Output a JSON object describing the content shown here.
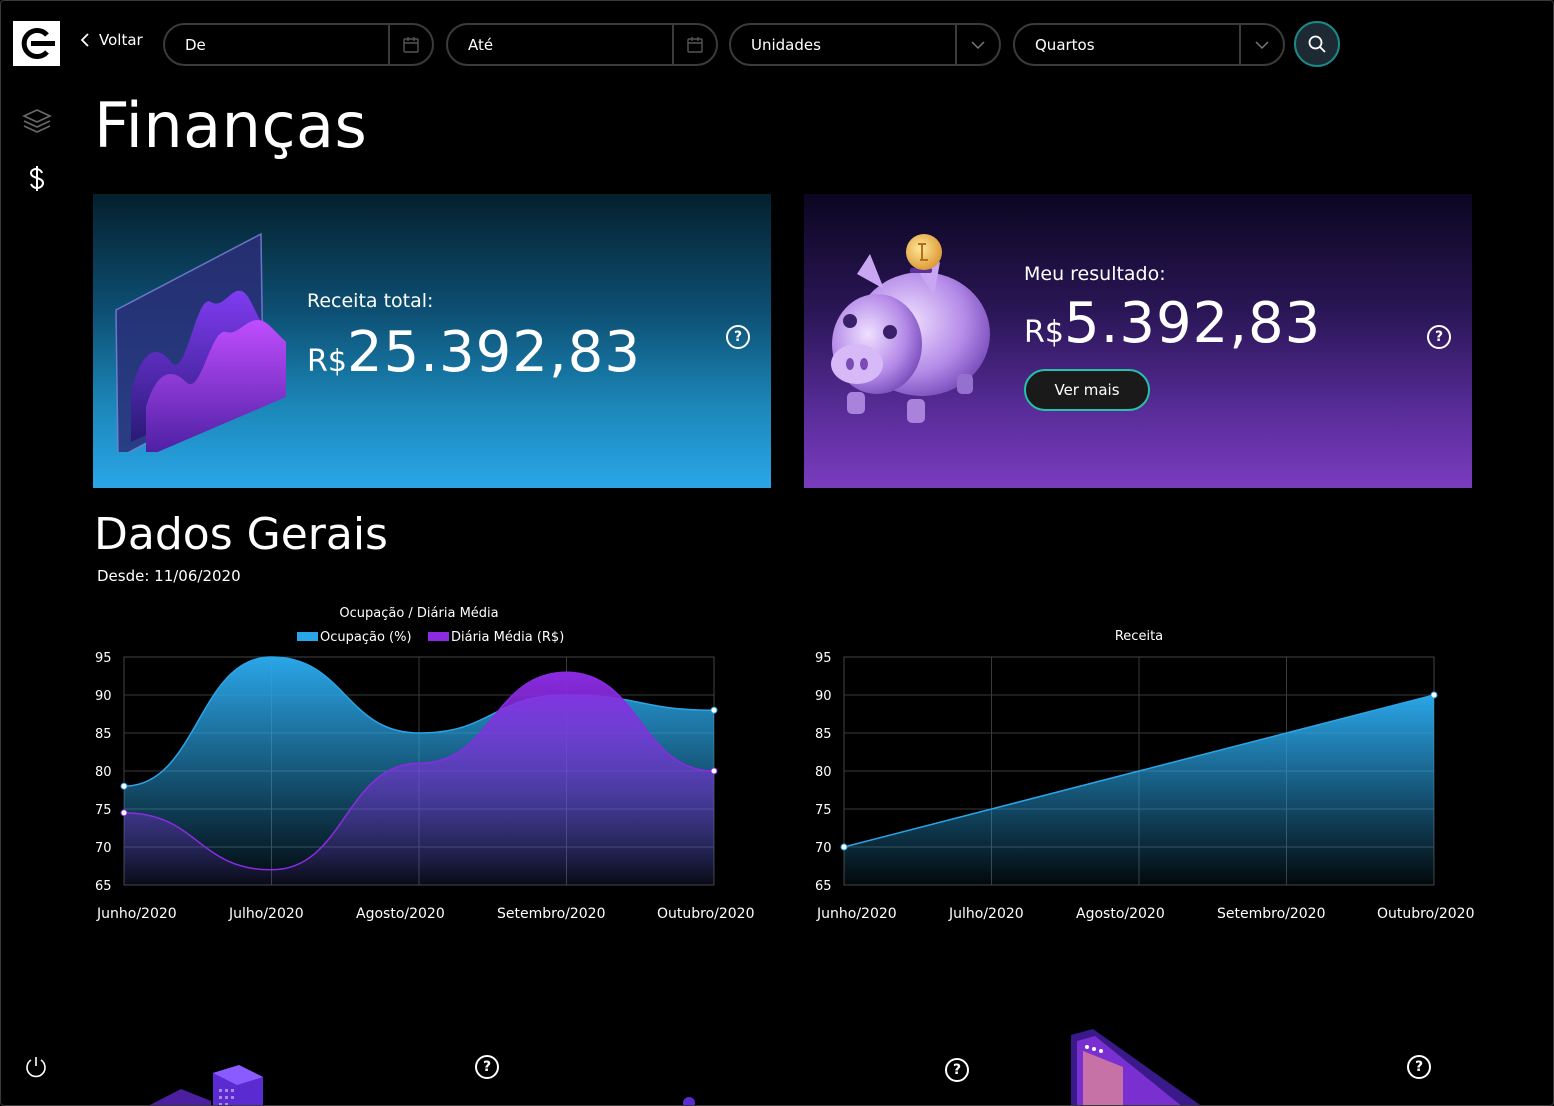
{
  "nav": {
    "back_label": "Voltar",
    "from_placeholder": "De",
    "to_placeholder": "Até",
    "units_label": "Unidades",
    "rooms_label": "Quartos"
  },
  "page": {
    "title": "Finanças",
    "section_title": "Dados Gerais",
    "since": "Desde: 11/06/2020"
  },
  "cards": {
    "revenue": {
      "label": "Receita total:",
      "currency": "R$",
      "amount": "25.392,83",
      "help": "?"
    },
    "result": {
      "label": "Meu resultado:",
      "currency": "R$",
      "amount": "5.392,83",
      "button": "Ver mais",
      "help": "?"
    }
  },
  "bottom_help": [
    "?",
    "?",
    "?"
  ],
  "colors": {
    "blue": "#2aa6e8",
    "purple": "#8a2be2",
    "accent_teal": "#24c2a8"
  },
  "icons": {
    "logo": "c-logo-icon",
    "sidebar": [
      "layers-icon",
      "dollar-icon"
    ],
    "power": "power-icon",
    "search": "search-icon",
    "calendar": "calendar-icon",
    "chevron": "chevron-down-icon",
    "back": "chevron-left-icon"
  },
  "chart_data": [
    {
      "type": "area",
      "title": "Ocupação / Diária Média",
      "categories": [
        "Junho/2020",
        "Julho/2020",
        "Agosto/2020",
        "Setembro/2020",
        "Outubro/2020"
      ],
      "ylim": [
        65,
        95
      ],
      "yticks": [
        95,
        90,
        85,
        80,
        75,
        70,
        65
      ],
      "grid": true,
      "legend": "top",
      "series": [
        {
          "name": "Ocupação (%)",
          "color": "#2aa6e8",
          "values": [
            78,
            95,
            85,
            90,
            88
          ]
        },
        {
          "name": "Diária Média (R$)",
          "color": "#8a2be2",
          "values": [
            74.5,
            67,
            81,
            93,
            80
          ]
        }
      ]
    },
    {
      "type": "area",
      "title": "Receita",
      "categories": [
        "Junho/2020",
        "Julho/2020",
        "Agosto/2020",
        "Setembro/2020",
        "Outubro/2020"
      ],
      "ylim": [
        65,
        95
      ],
      "yticks": [
        95,
        90,
        85,
        80,
        75,
        70,
        65
      ],
      "grid": true,
      "series": [
        {
          "color": "#2aa6e8",
          "values": [
            70,
            75,
            80,
            85,
            90
          ]
        }
      ]
    }
  ]
}
